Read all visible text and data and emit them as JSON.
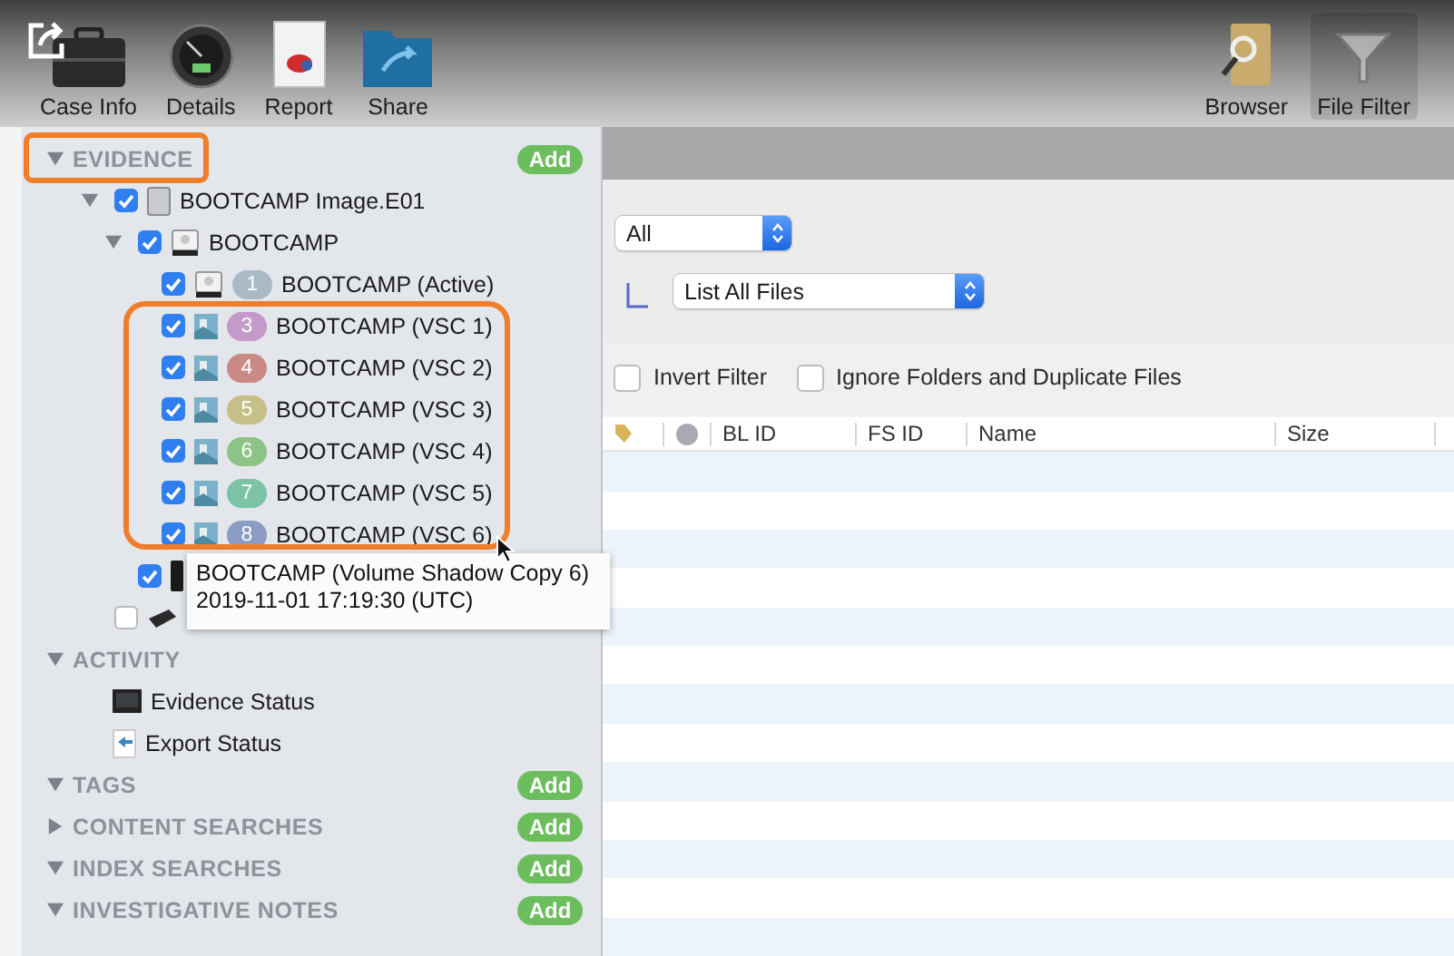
{
  "toolbar": {
    "left": [
      {
        "label": "Case Info",
        "kind": "case"
      },
      {
        "label": "Details",
        "kind": "gauge"
      },
      {
        "label": "Report",
        "kind": "report"
      },
      {
        "label": "Share",
        "kind": "share"
      }
    ],
    "right": [
      {
        "label": "Browser",
        "kind": "browser",
        "selected": false
      },
      {
        "label": "File Filter",
        "kind": "filter",
        "selected": true
      }
    ]
  },
  "sidebar": {
    "sections": [
      {
        "title": "EVIDENCE",
        "expanded": true,
        "add": "Add",
        "tree": [
          {
            "label": "BOOTCAMP Image.E01",
            "kind": "image",
            "checked": true,
            "expanded": true,
            "children": [
              {
                "label": "BOOTCAMP",
                "kind": "volume",
                "checked": true,
                "expanded": true,
                "children": [
                  {
                    "label": "BOOTCAMP (Active)",
                    "kind": "volume",
                    "checked": true,
                    "badge": {
                      "text": "1",
                      "color": "#a9b9c6"
                    }
                  },
                  {
                    "label": "BOOTCAMP (VSC 1)",
                    "kind": "snapshot",
                    "checked": true,
                    "badge": {
                      "text": "3",
                      "color": "#c49ac8"
                    }
                  },
                  {
                    "label": "BOOTCAMP (VSC 2)",
                    "kind": "snapshot",
                    "checked": true,
                    "badge": {
                      "text": "4",
                      "color": "#c98985"
                    }
                  },
                  {
                    "label": "BOOTCAMP (VSC 3)",
                    "kind": "snapshot",
                    "checked": true,
                    "badge": {
                      "text": "5",
                      "color": "#c6bf88"
                    }
                  },
                  {
                    "label": "BOOTCAMP (VSC 4)",
                    "kind": "snapshot",
                    "checked": true,
                    "badge": {
                      "text": "6",
                      "color": "#8dc486"
                    }
                  },
                  {
                    "label": "BOOTCAMP (VSC 5)",
                    "kind": "snapshot",
                    "checked": true,
                    "badge": {
                      "text": "7",
                      "color": "#7cc2a6"
                    }
                  },
                  {
                    "label": "BOOTCAMP (VSC 6)",
                    "kind": "snapshot",
                    "checked": true,
                    "badge": {
                      "text": "8",
                      "color": "#8a9cc4"
                    }
                  }
                ]
              },
              {
                "kind": "disk",
                "checked": true
              }
            ]
          },
          {
            "kind": "device",
            "checked": false
          }
        ]
      },
      {
        "title": "ACTIVITY",
        "expanded": true,
        "items": [
          {
            "label": "Evidence Status",
            "kind": "monitor"
          },
          {
            "label": "Export Status",
            "kind": "export"
          }
        ]
      },
      {
        "title": "TAGS",
        "expanded": true,
        "add": "Add"
      },
      {
        "title": "CONTENT SEARCHES",
        "expanded": false,
        "add": "Add"
      },
      {
        "title": "INDEX SEARCHES",
        "expanded": true,
        "add": "Add"
      },
      {
        "title": "INVESTIGATIVE NOTES",
        "expanded": true,
        "add": "Add"
      }
    ]
  },
  "tooltip": {
    "lines": [
      "BOOTCAMP (Volume Shadow Copy 6)",
      "2019-11-01 17:19:30 (UTC)"
    ]
  },
  "filter": {
    "scope": "All",
    "list": "List All Files",
    "options": [
      {
        "label": "Invert Filter",
        "checked": false
      },
      {
        "label": "Ignore Folders and Duplicate Files",
        "checked": false
      }
    ]
  },
  "table": {
    "columns": [
      {
        "kind": "tag"
      },
      {
        "kind": "color"
      },
      {
        "kind": "text",
        "label": "BL ID"
      },
      {
        "kind": "text",
        "label": "FS ID"
      },
      {
        "kind": "text",
        "label": "Name"
      },
      {
        "kind": "text",
        "label": "Size"
      }
    ]
  }
}
